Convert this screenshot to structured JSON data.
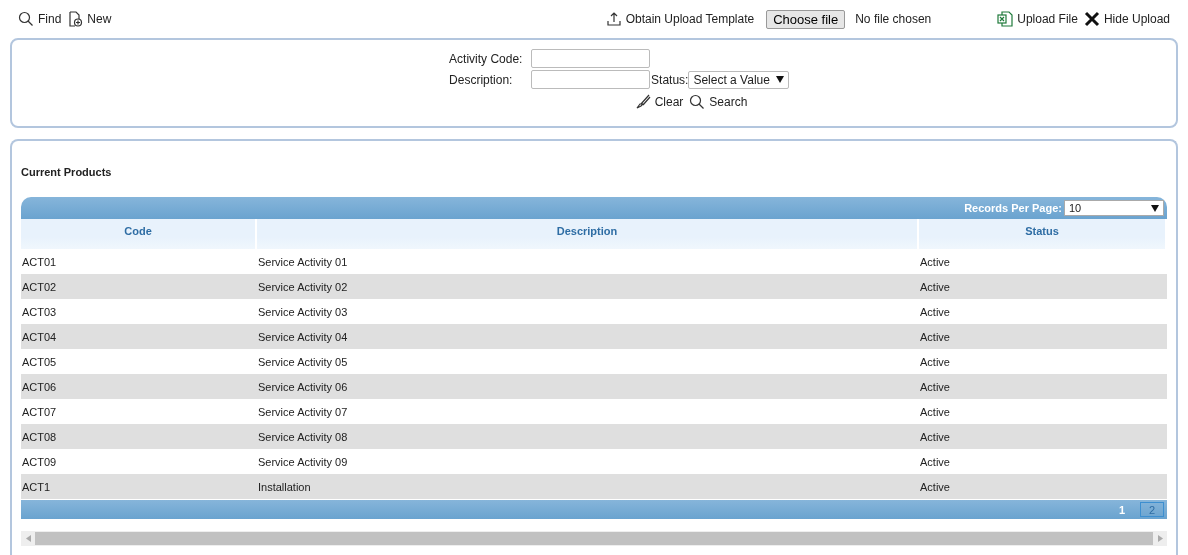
{
  "toolbar": {
    "left": [
      {
        "kind": "find",
        "label": "Find"
      },
      {
        "kind": "new",
        "label": "New"
      }
    ],
    "template": {
      "kind": "template",
      "label": "Obtain Upload Template"
    },
    "file": {
      "button": "Choose file",
      "status": "No file chosen"
    },
    "right": [
      {
        "kind": "upload",
        "label": "Upload File"
      },
      {
        "kind": "hide",
        "label": "Hide Upload"
      }
    ]
  },
  "filter": {
    "activity_code": {
      "label": "Activity Code:"
    },
    "description": {
      "label": "Description:"
    },
    "status": {
      "label": "Status:",
      "value": "Select a Value"
    },
    "actions": [
      {
        "kind": "clear",
        "label": "Clear"
      },
      {
        "kind": "search",
        "label": "Search"
      }
    ]
  },
  "products": {
    "title": "Current Products",
    "records_per_page": {
      "label": "Records Per Page:",
      "value": "10"
    },
    "columns": [
      "Code",
      "Description",
      "Status"
    ],
    "rows": [
      [
        "ACT01",
        "Service Activity 01",
        "Active"
      ],
      [
        "ACT02",
        "Service Activity 02",
        "Active"
      ],
      [
        "ACT03",
        "Service Activity 03",
        "Active"
      ],
      [
        "ACT04",
        "Service Activity 04",
        "Active"
      ],
      [
        "ACT05",
        "Service Activity 05",
        "Active"
      ],
      [
        "ACT06",
        "Service Activity 06",
        "Active"
      ],
      [
        "ACT07",
        "Service Activity 07",
        "Active"
      ],
      [
        "ACT08",
        "Service Activity 08",
        "Active"
      ],
      [
        "ACT09",
        "Service Activity 09",
        "Active"
      ],
      [
        "ACT1",
        "Installation",
        "Active"
      ]
    ],
    "pages": [
      {
        "label": "1",
        "selected": true
      },
      {
        "label": "2",
        "selected": false
      }
    ]
  }
}
